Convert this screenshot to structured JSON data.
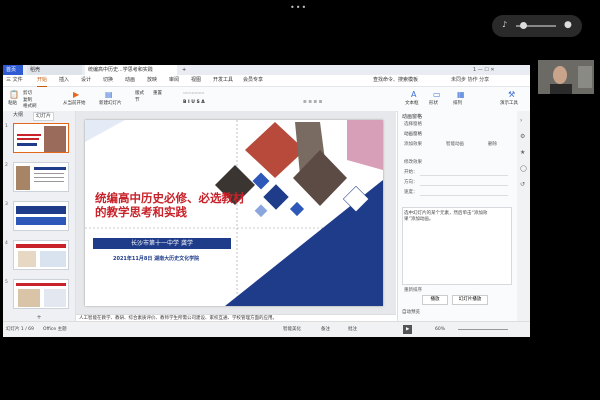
{
  "video": {
    "dots": "•••",
    "speaker_icon": "speaker-icon",
    "mic_icon": "mic-icon"
  },
  "tabs": {
    "home": "首页",
    "daoke": "稻壳",
    "ppt": "统编高中历史...学思考和实践",
    "plus": "+"
  },
  "titlebar_right": "1  —  ☐  ✕",
  "menu": {
    "file": "三 文件",
    "start": "开始",
    "insert": "插入",
    "design": "设计",
    "switch": "切换",
    "animation": "动画",
    "show": "放映",
    "review": "审阅",
    "view": "视图",
    "dev": "开发工具",
    "member": "会员专享",
    "search": "查找命令、搜索模板",
    "right": "未同步  协作  分享"
  },
  "ribbon": {
    "paste": "粘贴",
    "cut": "剪切",
    "copy": "复制",
    "format_painter": "格式刷",
    "play_from_current": "从当前开始",
    "new_slide": "新建幻灯片",
    "layout": "版式",
    "section": "节",
    "reset": "重置",
    "text_box": "文本框",
    "shape": "形状",
    "arrange": "排列",
    "toolbar": "演示工具"
  },
  "left_pane": {
    "tab_outline": "大纲",
    "tab_slides": "幻灯片",
    "add": "+",
    "numbers": [
      "1",
      "2",
      "3",
      "4",
      "5"
    ]
  },
  "slide": {
    "title": "统编高中历史必修、必选教材的教学思考和实践",
    "school": "长沙市第十一中学  龚学",
    "date": "2021年11月8日 湖南大历史文化学院"
  },
  "notes": "人工智能在教学、教研、综合素质评价、教师学生所需公司建设、家校互通、学校管理方面的应用。",
  "right_pane": {
    "title": "动画窗格",
    "select_pane": "选择窗格",
    "anim_pane": "动画窗格",
    "add_effect": "添加效果",
    "smart_anim": "智能动画",
    "delete": "删除",
    "modify": "修改效果",
    "start": "开始：",
    "property": "方向：",
    "speed": "速度：",
    "hint": "选中幻灯片的某个元素，然后单击“添加效果”添加动画。",
    "reorder": "重新排序",
    "play": "播放",
    "slideshow": "幻灯片播放",
    "auto_preview": "自动预览"
  },
  "status": {
    "slide_count": "幻灯片 1 / 69",
    "theme": "Office 主题",
    "beautify": "智能美化",
    "notes": "备注",
    "comment": "批注",
    "zoom": "60%"
  },
  "colors": {
    "accent_orange": "#e5671b",
    "title_red": "#c8222a",
    "navy": "#1f3c8a",
    "tab_blue": "#2f5bd3"
  }
}
